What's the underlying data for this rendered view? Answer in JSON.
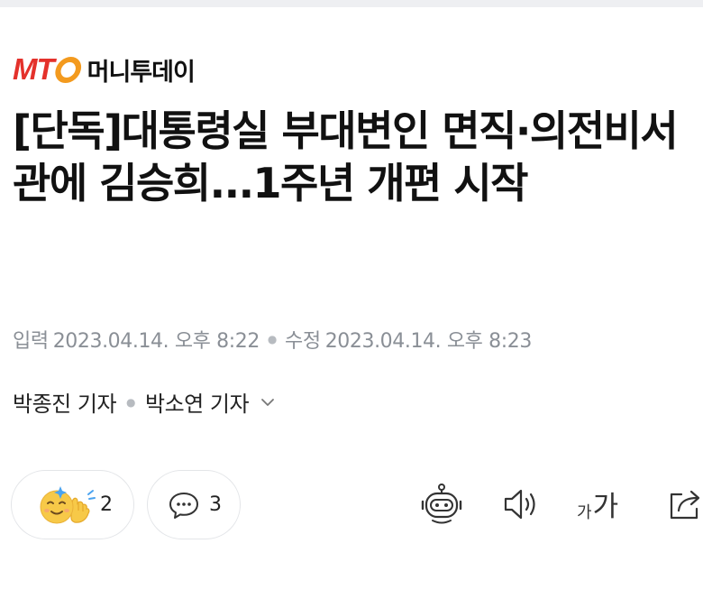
{
  "brand": {
    "logo_letters": "MTO",
    "name": "머니투데이",
    "colors": {
      "red": "#e4312b",
      "orange": "#f39a1e"
    }
  },
  "article": {
    "headline": "[단독]대통령실 부대변인 면직·의전비서관에 김승희...1주년 개편 시작",
    "input_label": "입력",
    "input_time": "2023.04.14. 오후 8:22",
    "edit_label": "수정",
    "edit_time": "2023.04.14. 오후 8:23",
    "reporters": [
      "박종진 기자",
      "박소연 기자"
    ]
  },
  "actions": {
    "reaction_count": "2",
    "comment_count": "3",
    "font_small": "가",
    "font_big": "가",
    "icons": [
      "reaction-emoji-icon",
      "comment-bubble-icon",
      "robot-summary-icon",
      "speaker-icon",
      "font-size-icon",
      "share-icon"
    ]
  }
}
